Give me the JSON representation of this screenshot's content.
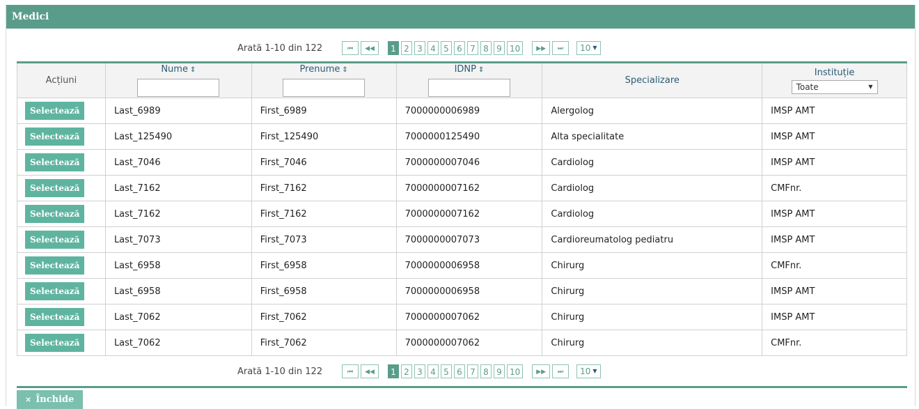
{
  "window": {
    "title": "Medici"
  },
  "pager": {
    "info": "Arată 1-10 din 122",
    "first": "⏮",
    "prev": "◀◀",
    "pages": [
      "1",
      "2",
      "3",
      "4",
      "5",
      "6",
      "7",
      "8",
      "9",
      "10"
    ],
    "active_page": "1",
    "next": "▶▶",
    "last": "⏭",
    "page_size": "10"
  },
  "table": {
    "headers": {
      "actions": "Acțiuni",
      "nume": "Nume",
      "prenume": "Prenume",
      "idnp": "IDNP",
      "specializare": "Specializare",
      "institutie": "Instituție"
    },
    "sort_icon": "⇕",
    "institutie_filter": "Toate",
    "select_label": "Selectează",
    "rows": [
      {
        "nume": "Last_6989",
        "prenume": "First_6989",
        "idnp": "7000000006989",
        "specializare": "Alergolog",
        "institutie": "IMSP AMT"
      },
      {
        "nume": "Last_125490",
        "prenume": "First_125490",
        "idnp": "7000000125490",
        "specializare": "Alta specialitate",
        "institutie": "IMSP AMT"
      },
      {
        "nume": "Last_7046",
        "prenume": "First_7046",
        "idnp": "7000000007046",
        "specializare": "Cardiolog",
        "institutie": "IMSP AMT"
      },
      {
        "nume": "Last_7162",
        "prenume": "First_7162",
        "idnp": "7000000007162",
        "specializare": "Cardiolog",
        "institutie": "CMFnr."
      },
      {
        "nume": "Last_7162",
        "prenume": "First_7162",
        "idnp": "7000000007162",
        "specializare": "Cardiolog",
        "institutie": "IMSP AMT"
      },
      {
        "nume": "Last_7073",
        "prenume": "First_7073",
        "idnp": "7000000007073",
        "specializare": "Cardioreumatolog pediatru",
        "institutie": "IMSP AMT"
      },
      {
        "nume": "Last_6958",
        "prenume": "First_6958",
        "idnp": "7000000006958",
        "specializare": "Chirurg",
        "institutie": "CMFnr."
      },
      {
        "nume": "Last_6958",
        "prenume": "First_6958",
        "idnp": "7000000006958",
        "specializare": "Chirurg",
        "institutie": "IMSP AMT"
      },
      {
        "nume": "Last_7062",
        "prenume": "First_7062",
        "idnp": "7000000007062",
        "specializare": "Chirurg",
        "institutie": "IMSP AMT"
      },
      {
        "nume": "Last_7062",
        "prenume": "First_7062",
        "idnp": "7000000007062",
        "specializare": "Chirurg",
        "institutie": "CMFnr."
      }
    ]
  },
  "footer": {
    "close_label": "Închide",
    "close_icon": "×"
  },
  "colors": {
    "accent": "#5a9c8a",
    "button": "#5fb4a0"
  }
}
